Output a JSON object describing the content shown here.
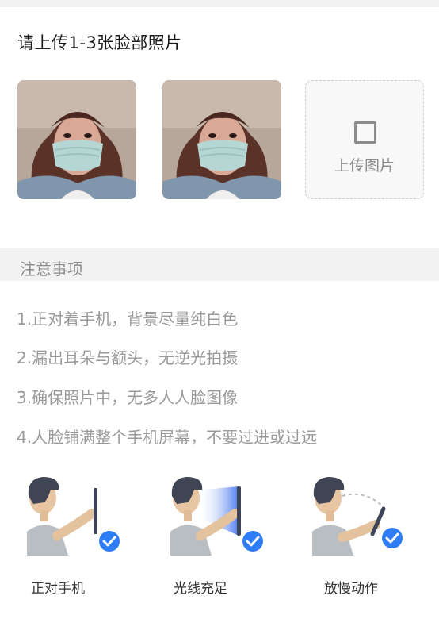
{
  "upload_section": {
    "title": "请上传1-3张脸部照片",
    "photos": [
      {
        "name": "face-photo-1"
      },
      {
        "name": "face-photo-2"
      }
    ],
    "upload_label": "上传图片"
  },
  "notice": {
    "title": "注意事项",
    "tips": [
      "1.正对着手机，背景尽量纯白色",
      "2.漏出耳朵与额头，无逆光拍摄",
      "3.确保照片中，无多人人脸图像",
      "4.人脸铺满整个手机屏幕，不要过进或过远"
    ]
  },
  "illustrations": [
    {
      "caption": "正对手机",
      "icon": "face-phone-icon"
    },
    {
      "caption": "光线充足",
      "icon": "light-sufficient-icon"
    },
    {
      "caption": "放慢动作",
      "icon": "slow-motion-icon"
    }
  ],
  "colors": {
    "check_blue": "#2f7df6",
    "divider": "#f2f2f2",
    "hint_text": "#999999"
  }
}
